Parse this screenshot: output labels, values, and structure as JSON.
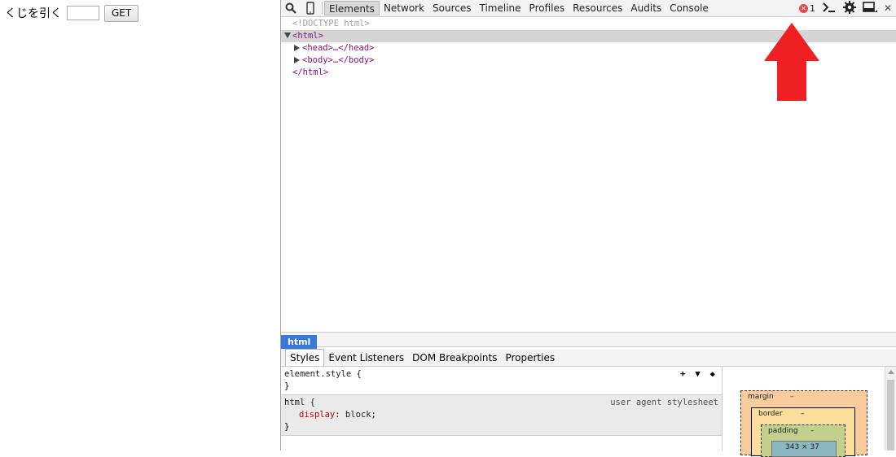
{
  "page": {
    "label": "くじを引く",
    "input_value": "",
    "button_label": "GET"
  },
  "devtools": {
    "tabs": [
      "Elements",
      "Network",
      "Sources",
      "Timeline",
      "Profiles",
      "Resources",
      "Audits",
      "Console"
    ],
    "active_tab": "Elements",
    "error_count": "1",
    "dom_tree": {
      "doctype": "<!DOCTYPE html>",
      "html_open": "<html>",
      "head": "<head>…</head>",
      "body": "<body>…</body>",
      "html_close": "</html>"
    },
    "breadcrumb": "html",
    "sidebar_tabs": [
      "Styles",
      "Event Listeners",
      "DOM Breakpoints",
      "Properties"
    ],
    "styles": {
      "element_style": "element.style {",
      "close_brace": "}",
      "html_rule": "html {",
      "html_prop": "display",
      "html_val": "block;",
      "html_source": "user agent stylesheet"
    },
    "metrics": {
      "margin": "margin",
      "border": "border",
      "padding": "padding",
      "dash": "–",
      "content": "343 × 37"
    }
  },
  "colors": {
    "accent": "#3879d9",
    "error": "#e34b4b",
    "arrow": "#ef2024"
  }
}
